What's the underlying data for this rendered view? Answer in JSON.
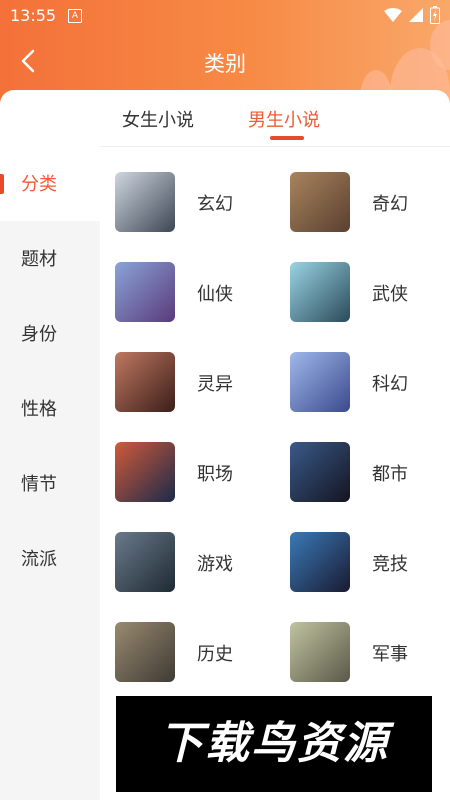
{
  "status": {
    "time": "13:55",
    "notif_icon": "A"
  },
  "header": {
    "title": "类别"
  },
  "tabs": [
    {
      "label": "女生小说",
      "active": false
    },
    {
      "label": "男生小说",
      "active": true
    }
  ],
  "sidebar": {
    "items": [
      {
        "label": "分类",
        "active": true
      },
      {
        "label": "题材",
        "active": false
      },
      {
        "label": "身份",
        "active": false
      },
      {
        "label": "性格",
        "active": false
      },
      {
        "label": "情节",
        "active": false
      },
      {
        "label": "流派",
        "active": false
      }
    ]
  },
  "categories": [
    {
      "label": "玄幻",
      "colors": [
        "#cfd6e0",
        "#3c4652"
      ]
    },
    {
      "label": "奇幻",
      "colors": [
        "#a8845e",
        "#5a4030"
      ]
    },
    {
      "label": "仙侠",
      "colors": [
        "#8aa4d8",
        "#5a3a7a"
      ]
    },
    {
      "label": "武侠",
      "colors": [
        "#9ad4e4",
        "#2a4a5a"
      ]
    },
    {
      "label": "灵异",
      "colors": [
        "#c07860",
        "#3a1e1a"
      ]
    },
    {
      "label": "科幻",
      "colors": [
        "#a0b8ec",
        "#3a4a8c"
      ]
    },
    {
      "label": "职场",
      "colors": [
        "#d05a3a",
        "#1a2a4a"
      ]
    },
    {
      "label": "都市",
      "colors": [
        "#3a5a8a",
        "#141420"
      ]
    },
    {
      "label": "游戏",
      "colors": [
        "#6a7a8a",
        "#1e2a34"
      ]
    },
    {
      "label": "竞技",
      "colors": [
        "#3a7ab8",
        "#1a1a30"
      ]
    },
    {
      "label": "历史",
      "colors": [
        "#9a8a70",
        "#3e3a34"
      ]
    },
    {
      "label": "军事",
      "colors": [
        "#c0c4a0",
        "#5a5848"
      ]
    }
  ],
  "watermark": {
    "text": "下载鸟资源"
  },
  "theme": {
    "accent": "#f05a35",
    "header_start": "#f4713a",
    "header_end": "#f9a86a"
  }
}
